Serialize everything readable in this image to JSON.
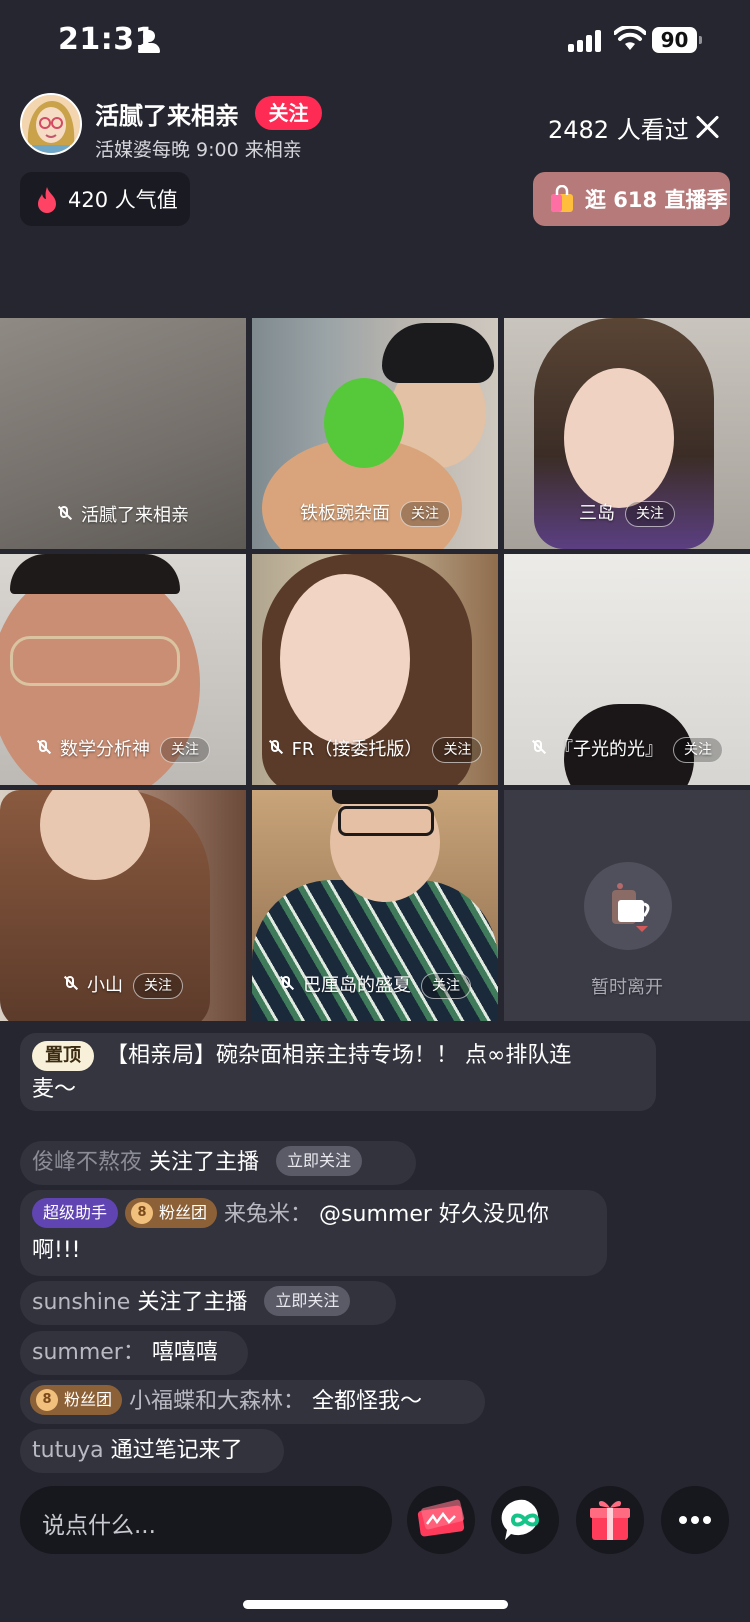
{
  "status_bar": {
    "time": "21:31",
    "battery": "90"
  },
  "host": {
    "name": "活腻了来相亲",
    "follow_label": "关注",
    "subtitle": "活媒婆每晚 9:00 来相亲",
    "viewers": "2482 人看过"
  },
  "popularity": {
    "label": "420 人气值"
  },
  "promo": {
    "label": "逛 618 直播季"
  },
  "tiles": [
    {
      "name": "活腻了来相亲",
      "follow": ""
    },
    {
      "name": "铁板豌杂面",
      "follow": "关注"
    },
    {
      "name": "三岛",
      "follow": "关注"
    },
    {
      "name": "数学分析神",
      "follow": "关注"
    },
    {
      "name": "FR（接委托版）",
      "follow": "关注"
    },
    {
      "name": "『子光的光』",
      "follow": "关注"
    },
    {
      "name": "小山",
      "follow": "关注"
    },
    {
      "name": "巴厘岛的盛夏",
      "follow": "关注"
    },
    {
      "name": "暂时离开",
      "follow": ""
    }
  ],
  "chat": {
    "pinned_badge": "置顶",
    "pinned_line1": "【相亲局】碗杂面相亲主持专场！！ 点∞排队连",
    "pinned_line2": "麦～",
    "follow_now": "立即关注",
    "msg1_user": "俊峰不熬夜",
    "msg1_text": "关注了主播",
    "msg2_badge_helper": "超级助手",
    "msg2_badge_fan": "粉丝团",
    "msg2_user": "来兔米：",
    "msg2_text_line1": "@summer 好久没见你",
    "msg2_text_line2": "啊!!!",
    "msg3_user": "sunshine",
    "msg3_text": "关注了主播",
    "msg4_user": "summer：",
    "msg4_text": "嘻嘻嘻",
    "msg5_badge_fan": "粉丝团",
    "msg5_user": "小福蝶和大森林：",
    "msg5_text": "全都怪我～",
    "msg6_user": "tutuya",
    "msg6_text": "通过笔记来了"
  },
  "input": {
    "placeholder": "说点什么..."
  },
  "icons": [
    "person-icon",
    "signal-icon",
    "wifi-icon",
    "battery-icon",
    "close-icon",
    "fire-icon",
    "shopping-bag-icon",
    "mic-muted-icon",
    "coffee-cup-icon",
    "popularity-ticket-icon",
    "link-mic-icon",
    "gift-icon",
    "more-icon"
  ],
  "colors": {
    "follow_red": "#fe2c55",
    "background": "#25262f",
    "promo": "#b67a7a",
    "helper_badge": "#5f44b2",
    "fan_badge": "#8d6137"
  }
}
